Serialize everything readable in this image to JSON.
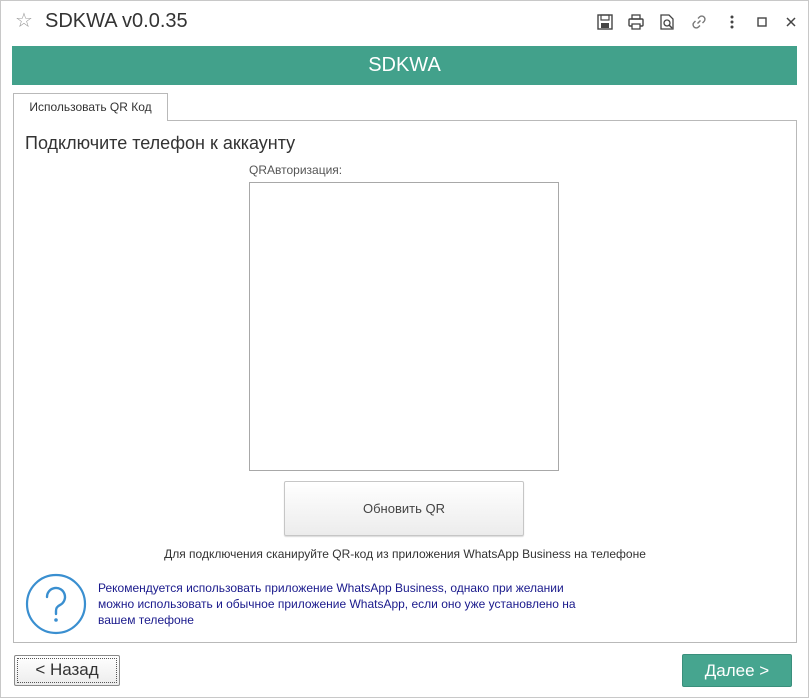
{
  "window": {
    "title": "SDKWA v0.0.35",
    "star_icon": "star-icon",
    "toolbar": [
      {
        "icon": "save-icon"
      },
      {
        "icon": "print-icon"
      },
      {
        "icon": "preview-icon"
      },
      {
        "icon": "link-icon"
      },
      {
        "icon": "more-icon"
      },
      {
        "icon": "maximize-icon"
      },
      {
        "icon": "close-icon"
      }
    ]
  },
  "header": {
    "text": "SDKWA",
    "color": "#42a18b"
  },
  "tabs": [
    {
      "label": "Использовать QR Код",
      "active": true
    }
  ],
  "main": {
    "heading": "Подключите телефон к аккаунту",
    "qr_label": "QRАвторизация:",
    "refresh_button": "Обновить QR",
    "instruction": "Для подключения сканируйте QR-код из приложения WhatsApp Business на телефоне",
    "help_icon": "question-icon",
    "help_text": "Рекомендуется использовать приложение WhatsApp Business, однако при желании можно использовать и обычное приложение WhatsApp, если оно уже установлено на вашем телефоне"
  },
  "footer": {
    "back_button": "< Назад",
    "next_button": "Далее >"
  },
  "colors": {
    "accent": "#42a18b",
    "help_text": "#1a1a8c",
    "help_icon": "#3a8fd0"
  }
}
